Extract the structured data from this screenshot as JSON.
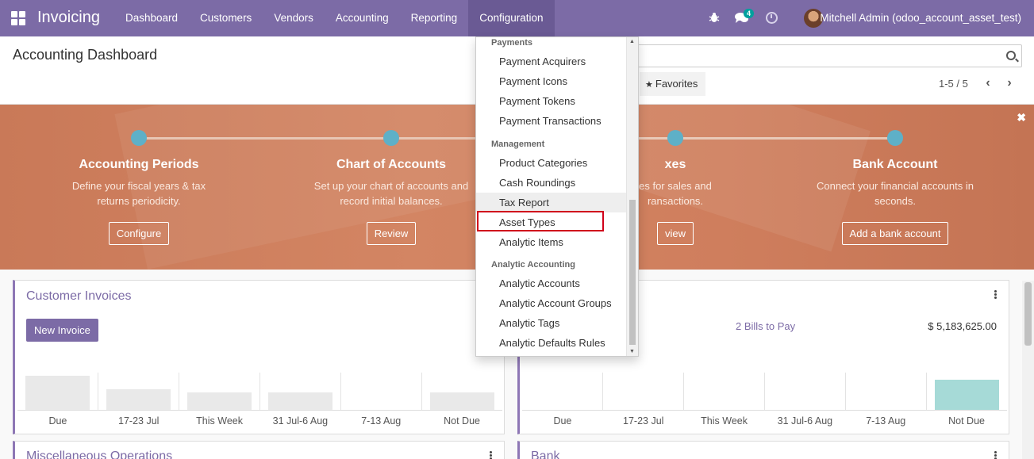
{
  "navbar": {
    "brand": "Invoicing",
    "menu": [
      "Dashboard",
      "Customers",
      "Vendors",
      "Accounting",
      "Reporting",
      "Configuration"
    ],
    "active_menu": "Configuration",
    "chat_badge": "4",
    "user": "Mitchell Admin (odoo_account_asset_test)",
    "bg_color": "#7c6ba6"
  },
  "control_panel": {
    "title": "Accounting Dashboard",
    "search_placeholder": "",
    "favorites_label": "Favorites",
    "pager": "1-5 / 5"
  },
  "banner": {
    "steps": [
      {
        "title": "Accounting Periods",
        "desc": "Define your fiscal years & tax returns periodicity.",
        "button": "Configure"
      },
      {
        "title": "Chart of Accounts",
        "desc": "Set up your chart of accounts and record initial balances.",
        "button": "Review"
      },
      {
        "title": "Taxes",
        "desc": "Set default Taxes for sales and purchase transactions.",
        "button": "Review"
      },
      {
        "title": "Bank Account",
        "desc": "Connect your financial accounts in seconds.",
        "button": "Add a bank account"
      }
    ],
    "visible_step3_title": "xes",
    "visible_step3_desc_1": "es for sales and",
    "visible_step3_desc_2": "ransactions.",
    "visible_step3_button": "view"
  },
  "cards": {
    "customer_invoices": {
      "title": "Customer Invoices",
      "button": "New Invoice",
      "labels": [
        "Due",
        "17-23 Jul",
        "This Week",
        "31 Jul-6 Aug",
        "7-13 Aug",
        "Not Due"
      ],
      "values": [
        0.9,
        0.55,
        0.45,
        0.45,
        0,
        0.45
      ]
    },
    "vendor_bills": {
      "bills_link": "2 Bills to Pay",
      "amount": "$ 5,183,625.00",
      "labels": [
        "Due",
        "17-23 Jul",
        "This Week",
        "31 Jul-6 Aug",
        "7-13 Aug",
        "Not Due"
      ],
      "values": [
        0,
        0,
        0,
        0,
        0,
        0.8
      ]
    },
    "misc": {
      "title": "Miscellaneous Operations"
    },
    "bank": {
      "title": "Bank"
    }
  },
  "dropdown": {
    "sections": [
      {
        "header": "Payments",
        "items": [
          "Payment Acquirers",
          "Payment Icons",
          "Payment Tokens",
          "Payment Transactions"
        ]
      },
      {
        "header": "Management",
        "items": [
          "Product Categories",
          "Cash Roundings",
          "Tax Report",
          "Asset Types",
          "Analytic Items"
        ]
      },
      {
        "header": "Analytic Accounting",
        "items": [
          "Analytic Accounts",
          "Analytic Account Groups",
          "Analytic Tags",
          "Analytic Defaults Rules"
        ]
      }
    ],
    "hovered_item": "Tax Report",
    "highlighted_item": "Asset Types"
  }
}
